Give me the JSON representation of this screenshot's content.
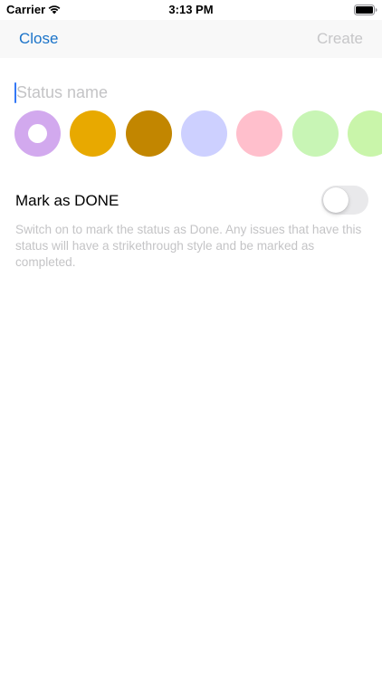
{
  "status_bar": {
    "carrier": "Carrier",
    "time": "3:13 PM",
    "icons": [
      "wifi-icon",
      "battery-icon"
    ]
  },
  "nav": {
    "close_label": "Close",
    "create_label": "Create",
    "create_enabled": false
  },
  "form": {
    "name_placeholder": "Status name",
    "name_value": ""
  },
  "colors": [
    {
      "hex": "#d2a9ee",
      "selected": true
    },
    {
      "hex": "#e8a900",
      "selected": false
    },
    {
      "hex": "#c28600",
      "selected": false
    },
    {
      "hex": "#cdd0ff",
      "selected": false
    },
    {
      "hex": "#ffbfcc",
      "selected": false
    },
    {
      "hex": "#c8f5b5",
      "selected": false
    },
    {
      "hex": "#c9f5aa",
      "selected": false
    }
  ],
  "done_toggle": {
    "label": "Mark as DONE",
    "checked": false,
    "help_text": "Switch on to mark the status as Done. Any issues that have this status will have a strikethrough style and be marked as completed."
  },
  "accent_color": "#1a73c9"
}
